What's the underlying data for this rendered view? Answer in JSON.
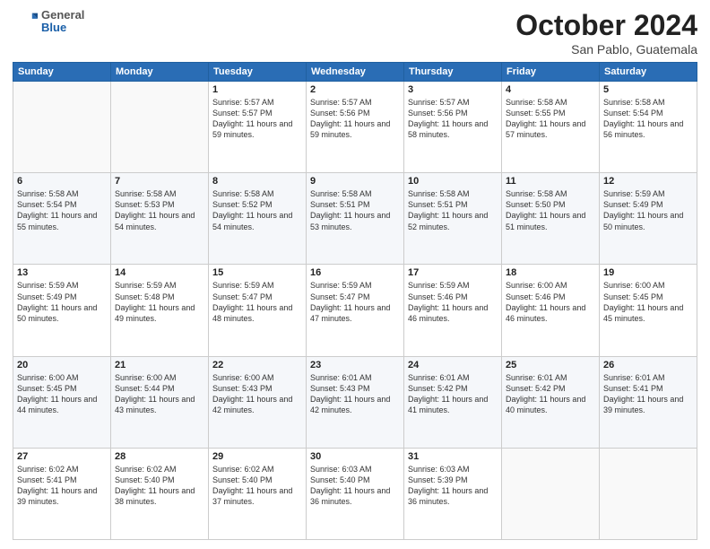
{
  "header": {
    "logo_general": "General",
    "logo_blue": "Blue",
    "month": "October 2024",
    "location": "San Pablo, Guatemala"
  },
  "days_of_week": [
    "Sunday",
    "Monday",
    "Tuesday",
    "Wednesday",
    "Thursday",
    "Friday",
    "Saturday"
  ],
  "weeks": [
    [
      {
        "day": "",
        "info": ""
      },
      {
        "day": "",
        "info": ""
      },
      {
        "day": "1",
        "info": "Sunrise: 5:57 AM\nSunset: 5:57 PM\nDaylight: 11 hours and 59 minutes."
      },
      {
        "day": "2",
        "info": "Sunrise: 5:57 AM\nSunset: 5:56 PM\nDaylight: 11 hours and 59 minutes."
      },
      {
        "day": "3",
        "info": "Sunrise: 5:57 AM\nSunset: 5:56 PM\nDaylight: 11 hours and 58 minutes."
      },
      {
        "day": "4",
        "info": "Sunrise: 5:58 AM\nSunset: 5:55 PM\nDaylight: 11 hours and 57 minutes."
      },
      {
        "day": "5",
        "info": "Sunrise: 5:58 AM\nSunset: 5:54 PM\nDaylight: 11 hours and 56 minutes."
      }
    ],
    [
      {
        "day": "6",
        "info": "Sunrise: 5:58 AM\nSunset: 5:54 PM\nDaylight: 11 hours and 55 minutes."
      },
      {
        "day": "7",
        "info": "Sunrise: 5:58 AM\nSunset: 5:53 PM\nDaylight: 11 hours and 54 minutes."
      },
      {
        "day": "8",
        "info": "Sunrise: 5:58 AM\nSunset: 5:52 PM\nDaylight: 11 hours and 54 minutes."
      },
      {
        "day": "9",
        "info": "Sunrise: 5:58 AM\nSunset: 5:51 PM\nDaylight: 11 hours and 53 minutes."
      },
      {
        "day": "10",
        "info": "Sunrise: 5:58 AM\nSunset: 5:51 PM\nDaylight: 11 hours and 52 minutes."
      },
      {
        "day": "11",
        "info": "Sunrise: 5:58 AM\nSunset: 5:50 PM\nDaylight: 11 hours and 51 minutes."
      },
      {
        "day": "12",
        "info": "Sunrise: 5:59 AM\nSunset: 5:49 PM\nDaylight: 11 hours and 50 minutes."
      }
    ],
    [
      {
        "day": "13",
        "info": "Sunrise: 5:59 AM\nSunset: 5:49 PM\nDaylight: 11 hours and 50 minutes."
      },
      {
        "day": "14",
        "info": "Sunrise: 5:59 AM\nSunset: 5:48 PM\nDaylight: 11 hours and 49 minutes."
      },
      {
        "day": "15",
        "info": "Sunrise: 5:59 AM\nSunset: 5:47 PM\nDaylight: 11 hours and 48 minutes."
      },
      {
        "day": "16",
        "info": "Sunrise: 5:59 AM\nSunset: 5:47 PM\nDaylight: 11 hours and 47 minutes."
      },
      {
        "day": "17",
        "info": "Sunrise: 5:59 AM\nSunset: 5:46 PM\nDaylight: 11 hours and 46 minutes."
      },
      {
        "day": "18",
        "info": "Sunrise: 6:00 AM\nSunset: 5:46 PM\nDaylight: 11 hours and 46 minutes."
      },
      {
        "day": "19",
        "info": "Sunrise: 6:00 AM\nSunset: 5:45 PM\nDaylight: 11 hours and 45 minutes."
      }
    ],
    [
      {
        "day": "20",
        "info": "Sunrise: 6:00 AM\nSunset: 5:45 PM\nDaylight: 11 hours and 44 minutes."
      },
      {
        "day": "21",
        "info": "Sunrise: 6:00 AM\nSunset: 5:44 PM\nDaylight: 11 hours and 43 minutes."
      },
      {
        "day": "22",
        "info": "Sunrise: 6:00 AM\nSunset: 5:43 PM\nDaylight: 11 hours and 42 minutes."
      },
      {
        "day": "23",
        "info": "Sunrise: 6:01 AM\nSunset: 5:43 PM\nDaylight: 11 hours and 42 minutes."
      },
      {
        "day": "24",
        "info": "Sunrise: 6:01 AM\nSunset: 5:42 PM\nDaylight: 11 hours and 41 minutes."
      },
      {
        "day": "25",
        "info": "Sunrise: 6:01 AM\nSunset: 5:42 PM\nDaylight: 11 hours and 40 minutes."
      },
      {
        "day": "26",
        "info": "Sunrise: 6:01 AM\nSunset: 5:41 PM\nDaylight: 11 hours and 39 minutes."
      }
    ],
    [
      {
        "day": "27",
        "info": "Sunrise: 6:02 AM\nSunset: 5:41 PM\nDaylight: 11 hours and 39 minutes."
      },
      {
        "day": "28",
        "info": "Sunrise: 6:02 AM\nSunset: 5:40 PM\nDaylight: 11 hours and 38 minutes."
      },
      {
        "day": "29",
        "info": "Sunrise: 6:02 AM\nSunset: 5:40 PM\nDaylight: 11 hours and 37 minutes."
      },
      {
        "day": "30",
        "info": "Sunrise: 6:03 AM\nSunset: 5:40 PM\nDaylight: 11 hours and 36 minutes."
      },
      {
        "day": "31",
        "info": "Sunrise: 6:03 AM\nSunset: 5:39 PM\nDaylight: 11 hours and 36 minutes."
      },
      {
        "day": "",
        "info": ""
      },
      {
        "day": "",
        "info": ""
      }
    ]
  ]
}
